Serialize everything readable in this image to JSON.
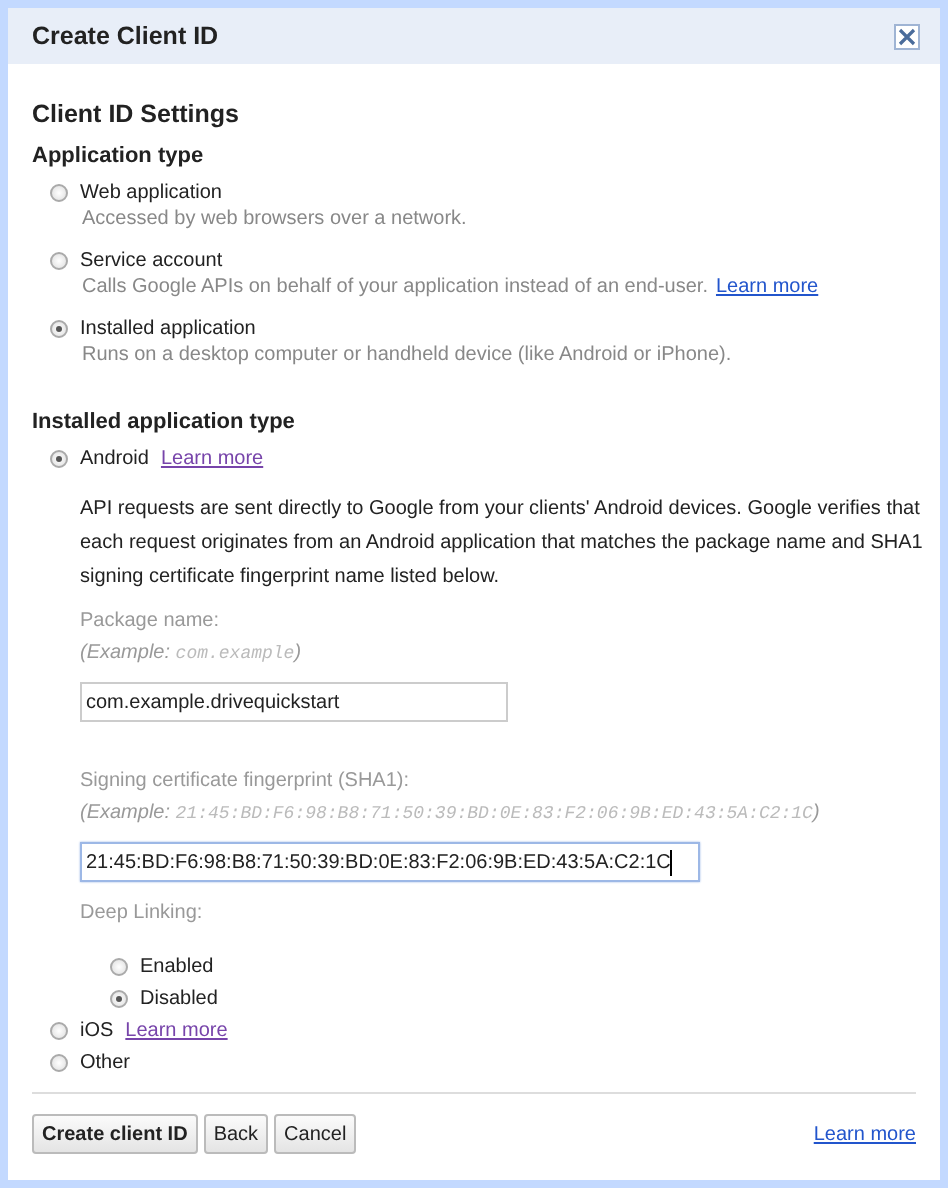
{
  "dialog": {
    "title": "Create Client ID"
  },
  "heading": "Client ID Settings",
  "application_type": {
    "label": "Application type",
    "options": [
      {
        "label": "Web application",
        "description": "Accessed by web browsers over a network.",
        "selected": false
      },
      {
        "label": "Service account",
        "description": "Calls Google APIs on behalf of your application instead of an end-user.",
        "link": {
          "text": "Learn more",
          "visited": false
        },
        "selected": false
      },
      {
        "label": "Installed application",
        "description": "Runs on a desktop computer or handheld device (like Android or iPhone).",
        "selected": true
      }
    ]
  },
  "installed_type": {
    "label": "Installed application type",
    "options": [
      {
        "label": "Android",
        "link": {
          "text": "Learn more",
          "visited": true
        },
        "selected": true
      },
      {
        "label": "iOS",
        "link": {
          "text": "Learn more",
          "visited": true
        },
        "selected": false
      },
      {
        "label": "Other",
        "selected": false
      }
    ]
  },
  "android": {
    "description": "API requests are sent directly to Google from your clients' Android devices. Google verifies that each request originates from an Android application that matches the package name and SHA1 signing certificate fingerprint name listed below.",
    "package_name": {
      "label": "Package name:",
      "example_prefix": "(Example:",
      "example": "com.example",
      "example_suffix": ")",
      "value": "com.example.drivequickstart",
      "focused": false
    },
    "fingerprint": {
      "label": "Signing certificate fingerprint (SHA1):",
      "example_prefix": "(Example:",
      "example": "21:45:BD:F6:98:B8:71:50:39:BD:0E:83:F2:06:9B:ED:43:5A:C2:1C",
      "example_suffix": ")",
      "value": "21:45:BD:F6:98:B8:71:50:39:BD:0E:83:F2:06:9B:ED:43:5A:C2:1C",
      "focused": true
    },
    "deep_linking": {
      "label": "Deep Linking:",
      "options": [
        {
          "label": "Enabled",
          "selected": false
        },
        {
          "label": "Disabled",
          "selected": true
        }
      ]
    }
  },
  "buttons": [
    {
      "label": "Create client ID",
      "primary": true
    },
    {
      "label": "Back",
      "primary": false
    },
    {
      "label": "Cancel",
      "primary": false
    }
  ],
  "footer_link": "Learn more"
}
